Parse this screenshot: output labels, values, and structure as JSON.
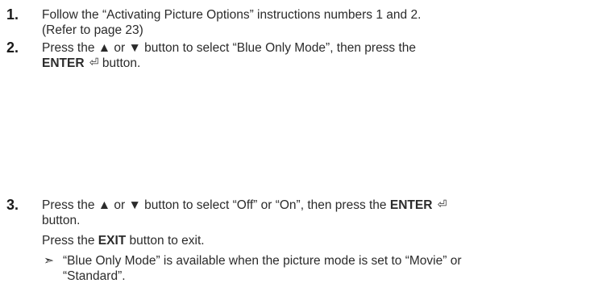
{
  "steps": [
    {
      "number": "1.",
      "lines": [
        "Follow the “Activating Picture Options” instructions numbers 1 and 2.",
        "(Refer to page 23)"
      ]
    },
    {
      "number": "2.",
      "line1": "Press the ▲ or ▼ button to select “Blue Only Mode”, then press the",
      "enter_label": "ENTER",
      "enter_icon": "⏎",
      "tail": " button."
    },
    {
      "number": "3.",
      "line1_pre": "Press the ▲ or ▼ button to select “Off” or “On”, then press the ",
      "enter_label": "ENTER",
      "enter_icon": "⏎",
      "line2": "button.",
      "exit_pre": "Press the ",
      "exit_label": "EXIT",
      "exit_post": " button to exit.",
      "note_arrow": "➣",
      "note_line1": "“Blue Only Mode” is available when the picture mode is set to “Movie” or",
      "note_line2": "“Standard”."
    }
  ]
}
